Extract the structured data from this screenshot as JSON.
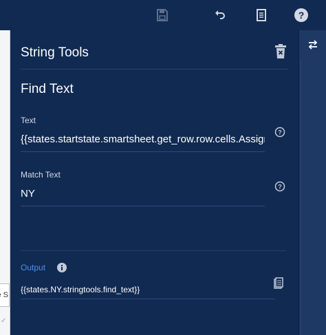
{
  "topbar": {
    "icons": [
      "save-icon",
      "undo-icon",
      "document-icon",
      "help-icon"
    ]
  },
  "sliver": {
    "node_text": "e S",
    "check": "✓"
  },
  "panel": {
    "title": "String Tools",
    "section_title": "Find Text",
    "fields": [
      {
        "label": "Text",
        "value": "{{states.startstate.smartsheet.get_row.row.cells.AssignedTo}}"
      },
      {
        "label": "Match Text",
        "value": "NY"
      }
    ],
    "output": {
      "label": "Output",
      "value": "{{states.NY.stringtools.find_text}}"
    }
  },
  "colors": {
    "panel_bg": "#102a52",
    "rail_bg": "#1e3a64",
    "output_label": "#4d90e8",
    "icon": "#c3cad6"
  }
}
